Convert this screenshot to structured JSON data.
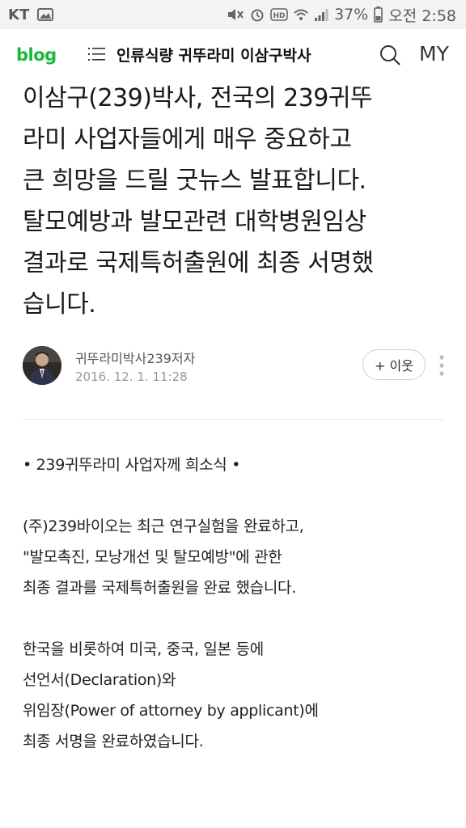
{
  "status_bar": {
    "carrier": "KT",
    "battery": "37%",
    "time": "오전 2:58"
  },
  "header": {
    "logo": "blog",
    "title": "인류식량 귀뚜라미 이삼구박사",
    "my_label": "MY"
  },
  "post": {
    "title": "이삼구(239)박사, 전국의 239귀뚜\n라미 사업자들에게 매우 중요하고\n큰 희망을 드릴 굿뉴스 발표합니다.\n탈모예방과 발모관련 대학병원임상\n결과로 국제특허출원에 최종 서명했\n습니다.",
    "author": "귀뚜라미박사239저자",
    "date": "2016. 12. 1. 11:28",
    "neighbor_button": "+ 이웃"
  },
  "body": {
    "heading": "• 239귀뚜라미 사업자께 희소식 •",
    "para1_line1": "(주)239바이오는 최근 연구실험을 완료하고,",
    "para1_line2": "\"발모촉진, 모낭개선 및 탈모예방\"에 관한",
    "para1_line3": "최종 결과를 국제특허출원을 완료 했습니다.",
    "para2_line1": "한국을 비롯하여 미국, 중국, 일본 등에",
    "para2_line2": "선언서(Declaration)와",
    "para2_line3": "위임장(Power of attorney by applicant)에",
    "para2_line4": "최종 서명을 완료하였습니다."
  },
  "icons": {
    "menu": "list-menu-icon",
    "search": "search-icon",
    "more": "vertical-dots-icon"
  },
  "colors": {
    "logo_green": "#19b93b",
    "status_bar_bg": "#f3f3f3"
  }
}
